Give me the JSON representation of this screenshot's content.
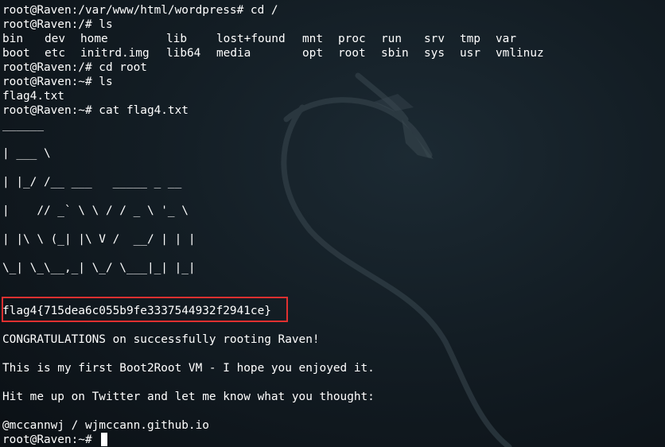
{
  "terminal": {
    "line1": "root@Raven:/var/www/html/wordpress# cd /",
    "line2": "root@Raven:/# ls",
    "ls_root": {
      "row1": [
        "bin",
        "dev",
        "home",
        "lib",
        "lost+found",
        "mnt",
        "proc",
        "run",
        "srv",
        "tmp",
        "var"
      ],
      "row2": [
        "boot",
        "etc",
        "initrd.img",
        "lib64",
        "media",
        "opt",
        "root",
        "sbin",
        "sys",
        "usr",
        "vmlinuz"
      ]
    },
    "line5": "root@Raven:/# cd root",
    "line6": "root@Raven:~# ls",
    "line7": "flag4.txt",
    "line8": "root@Raven:~# cat flag4.txt",
    "ascii_art": [
      "______",
      "| ___ \\",
      "| |_/ /__ ___   _____ _ __",
      "|    // _` \\ \\ / / _ \\ '_ \\",
      "| |\\ \\ (_| |\\ V /  __/ | | |",
      "\\_| \\_\\__,_| \\_/ \\___|_| |_|"
    ],
    "flag": "flag4{715dea6c055b9fe3337544932f2941ce}",
    "congrats": "CONGRATULATIONS on successfully rooting Raven!",
    "first_vm": "This is my first Boot2Root VM - I hope you enjoyed it.",
    "twitter": "Hit me up on Twitter and let me know what you thought:",
    "contact": "@mccannwj / wjmccann.github.io",
    "prompt": "root@Raven:~# "
  },
  "colors": {
    "text": "#ffffff",
    "background": "#131d24",
    "highlight_box": "#e03030"
  }
}
